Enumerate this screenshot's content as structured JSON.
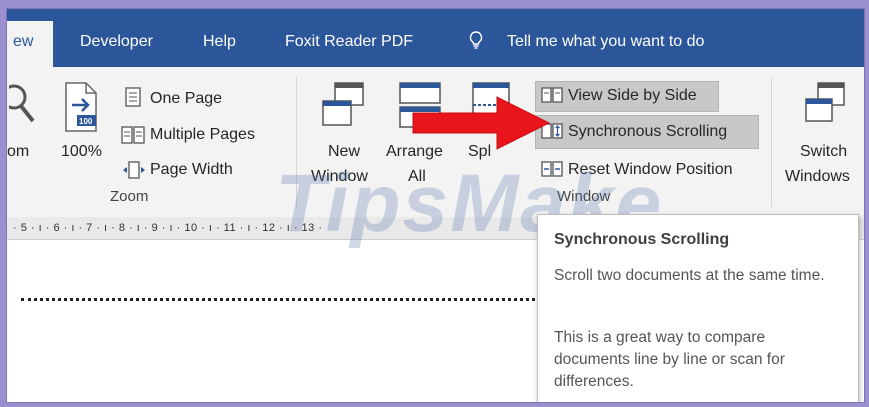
{
  "tabs": {
    "active_partial": "ew",
    "developer": "Developer",
    "help": "Help",
    "foxit": "Foxit Reader PDF",
    "tell_me": "Tell me what you want to do"
  },
  "zoom_group": {
    "zoom_partial": "om",
    "hundred_icon_text": "100",
    "hundred_label": "100%",
    "one_page": "One Page",
    "multiple_pages": "Multiple Pages",
    "page_width": "Page Width",
    "label": "Zoom"
  },
  "window_group": {
    "new_window_line1": "New",
    "new_window_line2": "Window",
    "arrange_all_line1": "Arrange",
    "arrange_all_line2": "All",
    "split_partial": "Spl",
    "view_side_by_side": "View Side by Side",
    "synchronous_scrolling": "Synchronous Scrolling",
    "reset_window_position": "Reset Window Position",
    "switch_windows_line1": "Switch",
    "switch_windows_line2": "Windows",
    "label": "Window"
  },
  "ruler": {
    "text": "· 5 · ı · 6 · ı · 7 · ı · 8 · ı · 9 · ı · 10 · ı · 11 · ı · 12 · ı · 13 ·"
  },
  "watermark": "TipsMake",
  "tooltip": {
    "title": "Synchronous Scrolling",
    "line1": "Scroll two documents at the same time.",
    "line2": "This is a great way to compare documents line by line or scan for differences."
  },
  "colors": {
    "tab_bar": "#2b579a",
    "ribbon_bg": "#f3f3f3",
    "highlight": "#c8c8c8",
    "arrow": "#e8151b"
  }
}
